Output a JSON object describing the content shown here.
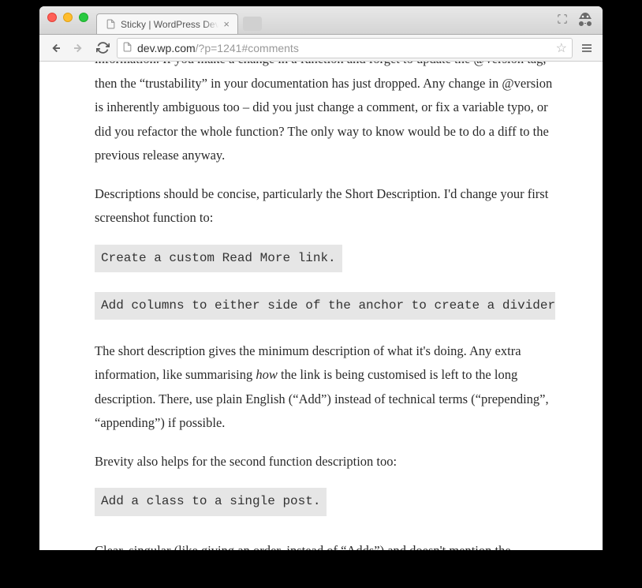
{
  "window": {
    "tab_title": "Sticky | WordPress Develop"
  },
  "toolbar": {
    "url_host": "dev.wp.com",
    "url_path": "/?p=1241#comments"
  },
  "content": {
    "p1_a": "information. If you make a change in a function and forget to update the @version tag, then the “trustability” in your documentation has just dropped. Any change in @version is inherently ambiguous too – did you just change a comment, or fix a variable typo, or did you refactor the whole function? The only way to know would be to do a diff to the previous release anyway.",
    "p2": "Descriptions should be concise, particularly the Short Description. I'd change your first screenshot function to:",
    "code1": "Create a custom Read More link.",
    "code2": "Add columns to either side of the anchor to create a divider between",
    "p3_a": "The short description gives the minimum description of what it's doing. Any extra information, like summarising ",
    "p3_em": "how",
    "p3_b": " the link is being customised is left to the long description. There, use plain English (“Add”) instead of technical terms (“prepending”, “appending”) if possible.",
    "p4": "Brevity also helps for the second function description too:",
    "code3": "Add a class to a single post.",
    "p5": "Clear, singular (like giving an order, instead of “Adds”) and doesn't mention the"
  }
}
